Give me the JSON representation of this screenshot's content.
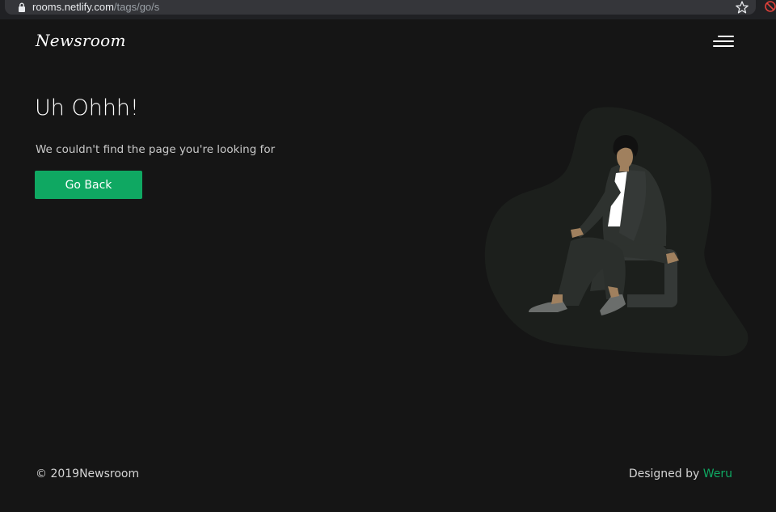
{
  "browser": {
    "url_domain": "rooms.netlify.com",
    "url_path": "/tags/go/s"
  },
  "header": {
    "logo": "Newsroom",
    "menu_icon": "hamburger-menu-icon"
  },
  "main": {
    "title": "Uh Ohhh!",
    "message": "We couldn't find the page you're looking for",
    "button_label": "Go Back"
  },
  "footer": {
    "copyright": "© 2019Newsroom",
    "designed_by_prefix": "Designed by ",
    "designer": "Weru"
  },
  "colors": {
    "background": "#151515",
    "accent": "#0fa862",
    "blob": "#1c1f1c"
  }
}
